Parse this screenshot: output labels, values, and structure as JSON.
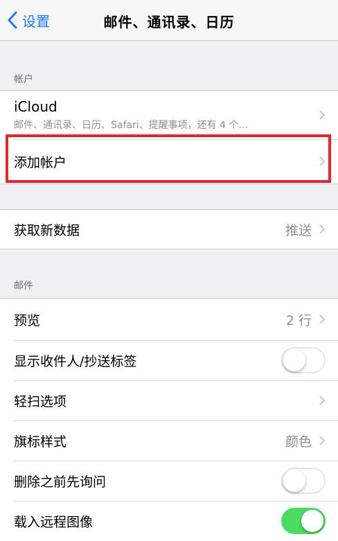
{
  "nav": {
    "back_label": "设置",
    "title": "邮件、通讯录、日历"
  },
  "accounts": {
    "header": "帐户",
    "icloud": {
      "title": "iCloud",
      "subtitle": "邮件、通讯录、日历、Safari、提醒事项，还有 4 个…"
    },
    "add_account": "添加帐户"
  },
  "fetch": {
    "label": "获取新数据",
    "value": "推送"
  },
  "mail": {
    "header": "邮件",
    "preview": {
      "label": "预览",
      "value": "2 行"
    },
    "show_to_cc": {
      "label": "显示收件人/抄送标签",
      "on": false
    },
    "swipe": {
      "label": "轻扫选项"
    },
    "flag_style": {
      "label": "旗标样式",
      "value": "颜色"
    },
    "ask_before_delete": {
      "label": "删除之前先询问",
      "on": false
    },
    "load_remote_images": {
      "label": "载入远程图像",
      "on": true
    }
  },
  "colors": {
    "accent": "#1a7cf5",
    "toggle_on": "#4cd964",
    "highlight": "#e0262e"
  }
}
